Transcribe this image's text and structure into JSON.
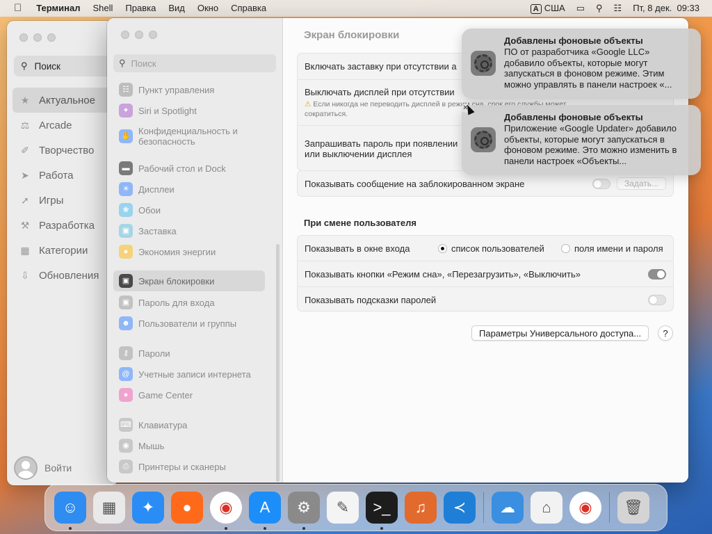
{
  "menubar": {
    "app": "Терминал",
    "items": [
      "Shell",
      "Правка",
      "Вид",
      "Окно",
      "Справка"
    ],
    "input_source_key": "A",
    "input_source": "США",
    "datetime": "Пт, 8 дек.  09:33"
  },
  "appstore": {
    "search_placeholder": "Поиск",
    "nav": [
      {
        "label": "Актуальное",
        "icon": "star-icon"
      },
      {
        "label": "Arcade",
        "icon": "joystick-icon"
      },
      {
        "label": "Творчество",
        "icon": "brush-icon"
      },
      {
        "label": "Работа",
        "icon": "paperplane-icon"
      },
      {
        "label": "Игры",
        "icon": "rocket-icon"
      },
      {
        "label": "Разработка",
        "icon": "hammer-icon"
      },
      {
        "label": "Категории",
        "icon": "grid-icon"
      },
      {
        "label": "Обновления",
        "icon": "download-icon"
      }
    ],
    "login": "Войти"
  },
  "settings": {
    "search_placeholder": "Поиск",
    "sidebar": [
      {
        "label": "Пункт управления",
        "color": "#9a9a9a"
      },
      {
        "label": "Siri и Spotlight",
        "color": "#a86ac6"
      },
      {
        "label": "Конфиденциальность и безопасность",
        "color": "#3a82f6"
      },
      {
        "label": "Рабочий стол и Dock",
        "color": "#3a3a3a"
      },
      {
        "label": "Дисплеи",
        "color": "#3a82f6"
      },
      {
        "label": "Обои",
        "color": "#33a9e0"
      },
      {
        "label": "Заставка",
        "color": "#56b6d6"
      },
      {
        "label": "Экономия энергии",
        "color": "#f4b400"
      },
      {
        "label": "Экран блокировки",
        "color": "#2b2b2b"
      },
      {
        "label": "Пароль для входа",
        "color": "#9a9a9a"
      },
      {
        "label": "Пользователи и группы",
        "color": "#3a82f6"
      },
      {
        "label": "Пароли",
        "color": "#9a9a9a"
      },
      {
        "label": "Учетные записи интернета",
        "color": "#3a82f6"
      },
      {
        "label": "Game Center",
        "color": "#e05ba6"
      },
      {
        "label": "Клавиатура",
        "color": "#9a9a9a"
      },
      {
        "label": "Мышь",
        "color": "#9a9a9a"
      },
      {
        "label": "Принтеры и сканеры",
        "color": "#9a9a9a"
      }
    ],
    "title": "Экран блокировки",
    "rows": {
      "screensaver": "Включать заставку при отсутствии а",
      "display_off": "Выключать дисплей при отсутствии",
      "display_off_note": "Если никогда не переводить дисплей в режим сна, срок его службы может сократиться.",
      "password_line1": "Запрашивать пароль при появлении",
      "password_line2": "или выключении дисплея",
      "show_message": "Показывать сообщение на заблокированном экране",
      "set_button": "Задать..."
    },
    "section_user_switch": "При смене пользователя",
    "login_window": {
      "label": "Показывать в окне входа",
      "option_list": "список пользователей",
      "option_fields": "поля имени и пароля"
    },
    "show_buttons": "Показывать кнопки «Режим сна», «Перезагрузить», «Выключить»",
    "show_hints": "Показывать подсказки паролей",
    "accessibility_button": "Параметры Универсального доступа...",
    "help": "?"
  },
  "notifications": [
    {
      "title": "Добавлены фоновые объекты",
      "body": "ПО от разработчика «Google LLC» добавило объекты, которые могут запускаться в фоновом режиме. Этим можно управлять в панели настроек «..."
    },
    {
      "title": "Добавлены фоновые объекты",
      "body": "Приложение «Google Updater» добавило объекты, которые могут запускаться в фоновом режиме. Это можно изменить в панели настроек «Объекты..."
    }
  ],
  "dock": [
    {
      "name": "finder-icon",
      "bg": "#2f8cf0",
      "glyph": "☺",
      "running": true
    },
    {
      "name": "launchpad-icon",
      "bg": "#e9e9e9",
      "glyph": "▦",
      "running": false
    },
    {
      "name": "safari-icon",
      "bg": "#2a8df5",
      "glyph": "✦",
      "running": false
    },
    {
      "name": "firefox-icon",
      "bg": "#ff6a1a",
      "glyph": "●",
      "running": false
    },
    {
      "name": "chrome-icon",
      "bg": "#ffffff",
      "glyph": "◉",
      "running": true
    },
    {
      "name": "app-store-icon",
      "bg": "#1c8ef9",
      "glyph": "A",
      "running": true
    },
    {
      "name": "system-settings-icon",
      "bg": "#8a8a8a",
      "glyph": "⚙",
      "running": true
    },
    {
      "name": "textedit-icon",
      "bg": "#f4f4f4",
      "glyph": "✎",
      "running": false
    },
    {
      "name": "terminal-icon",
      "bg": "#1d1d1d",
      "glyph": ">_",
      "running": true
    },
    {
      "name": "garageband-icon",
      "bg": "#e26a2c",
      "glyph": "♫",
      "running": false
    },
    {
      "name": "vscode-icon",
      "bg": "#1f7fd6",
      "glyph": "≺",
      "running": false
    },
    {
      "name": "weather-icon",
      "bg": "#3a8fe0",
      "glyph": "☁",
      "running": false
    },
    {
      "name": "preview-icon",
      "bg": "#f2f2f2",
      "glyph": "⌂",
      "running": false
    },
    {
      "name": "chrome-app-icon",
      "bg": "#ffffff",
      "glyph": "◉",
      "running": false
    },
    {
      "name": "trash-icon",
      "bg": "#d4d4d4",
      "glyph": "🗑",
      "running": false
    }
  ]
}
